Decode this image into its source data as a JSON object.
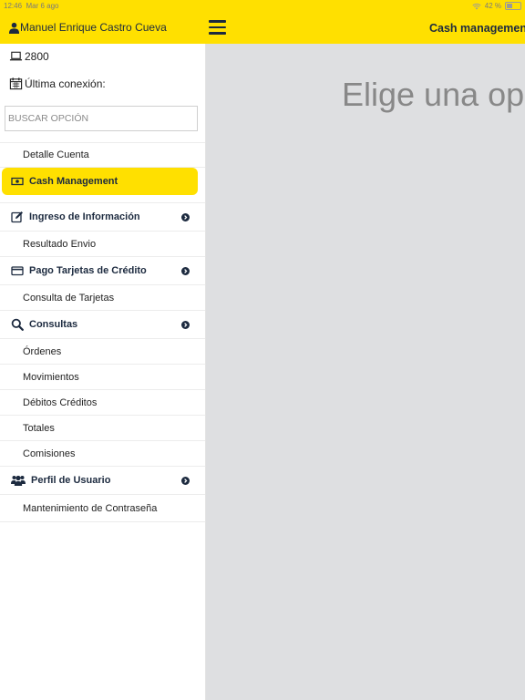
{
  "status_bar": {
    "time": "12:46",
    "date": "Mar 6 ago",
    "battery": "42 %",
    "battery_level": 0.42
  },
  "header": {
    "user_name": "Manuel Enrique Castro Cueva",
    "title": "Cash managemen"
  },
  "sidebar": {
    "code": "2800",
    "last_connection_label": "Última conexión:",
    "search_placeholder": "BUSCAR OPCIÓN",
    "items": [
      {
        "label": "Detalle Cuenta"
      },
      {
        "label": "Cash Management"
      },
      {
        "label": "Ingreso de Información"
      },
      {
        "label": "Resultado Envio"
      },
      {
        "label": "Pago Tarjetas de Crédito"
      },
      {
        "label": "Consulta de Tarjetas"
      },
      {
        "label": "Consultas"
      },
      {
        "label": "Órdenes"
      },
      {
        "label": "Movimientos"
      },
      {
        "label": "Débitos Créditos"
      },
      {
        "label": "Totales"
      },
      {
        "label": "Comisiones"
      },
      {
        "label": "Perfil de Usuario"
      },
      {
        "label": "Mantenimiento de Contraseña"
      }
    ]
  },
  "main": {
    "message": "Elige una op"
  },
  "colors": {
    "accent": "#ffe000",
    "text_dark": "#1c2a3f",
    "main_bg": "#dedfe1"
  }
}
